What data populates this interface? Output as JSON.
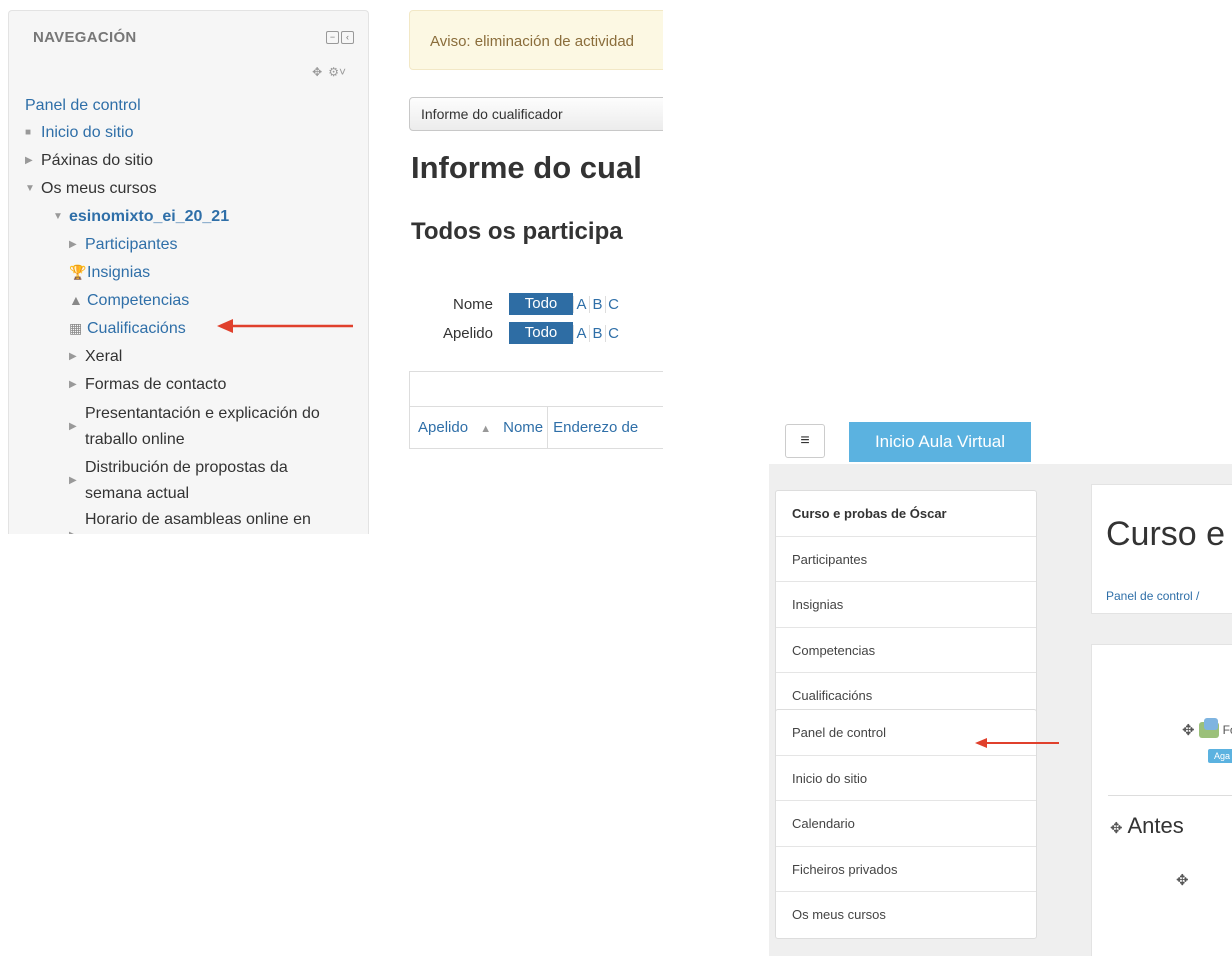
{
  "left_panel": {
    "title": "NAVEGACIÓN",
    "items": [
      {
        "label": "Panel de control"
      },
      {
        "label": "Inicio do sitio"
      },
      {
        "label": "Páxinas do sitio"
      },
      {
        "label": "Os meus cursos"
      },
      {
        "label": "esinomixto_ei_20_21"
      },
      {
        "label": "Participantes"
      },
      {
        "label": "Insignias"
      },
      {
        "label": "Competencias"
      },
      {
        "label": "Cualificacións"
      },
      {
        "label": "Xeral"
      },
      {
        "label": "Formas de contacto"
      },
      {
        "label": "Presentantación e explicación do traballo online"
      },
      {
        "label": "Distribución de propostas da semana actual"
      },
      {
        "label": "Horario de asambleas online en"
      }
    ]
  },
  "report": {
    "alert": "Aviso: eliminación de actividad",
    "selector_value": "Informe do cualificador",
    "heading": "Informe do cual",
    "subheading": "Todos os participa",
    "filter_first_label": "Nome",
    "filter_last_label": "Apelido",
    "filter_all": "Todo",
    "letters": [
      "A",
      "B",
      "C"
    ],
    "columns": [
      "Apelido",
      "Nome",
      "Enderezo de"
    ]
  },
  "boost": {
    "menu_icon": "≡",
    "home_button": "Inicio Aula Virtual",
    "course_nav": [
      {
        "label": "Curso e probas de Óscar"
      },
      {
        "label": "Participantes"
      },
      {
        "label": "Insignias"
      },
      {
        "label": "Competencias"
      },
      {
        "label": "Cualificacións"
      }
    ],
    "site_nav": [
      {
        "label": "Panel de control"
      },
      {
        "label": "Inicio do sitio"
      },
      {
        "label": "Calendario"
      },
      {
        "label": "Ficheiros privados"
      },
      {
        "label": "Os meus cursos"
      }
    ],
    "course_title": "Curso e",
    "breadcrumb": "Panel de control /",
    "forum_text": "Foro",
    "badge_text": "Aga",
    "section_title": "Antes"
  },
  "colors": {
    "link": "#2f6fa8",
    "accent_blue": "#5bb2e0",
    "filter_active": "#2e6da4",
    "annotation_arrow": "#e0402c",
    "alert_bg": "#fcf8e3"
  }
}
